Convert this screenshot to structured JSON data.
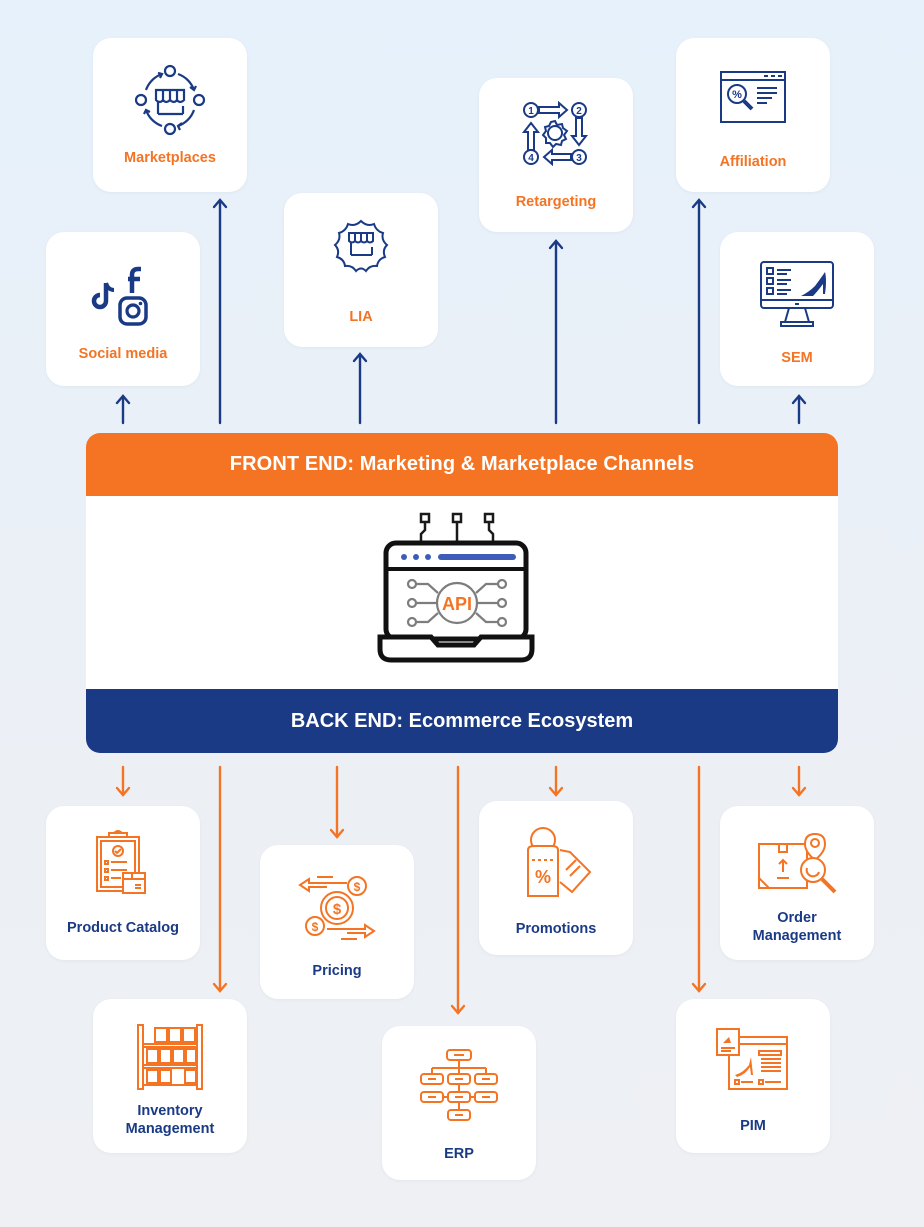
{
  "hub": {
    "front_end_label": "FRONT END: Marketing & Marketplace Channels",
    "back_end_label": "BACK END: Ecommerce Ecosystem",
    "center_icon_text": "API"
  },
  "front_end_channels": [
    {
      "id": "marketplaces",
      "label": "Marketplaces",
      "icon": "marketplace-cycle-icon"
    },
    {
      "id": "social-media",
      "label": "Social media",
      "icon": "social-media-icon"
    },
    {
      "id": "lia",
      "label": "LIA",
      "icon": "store-badge-icon"
    },
    {
      "id": "retargeting",
      "label": "Retargeting",
      "icon": "retargeting-cycle-icon"
    },
    {
      "id": "affiliation",
      "label": "Affiliation",
      "icon": "browser-discount-search-icon"
    },
    {
      "id": "sem",
      "label": "SEM",
      "icon": "monitor-product-icon"
    }
  ],
  "back_end_systems": [
    {
      "id": "product-catalog",
      "label": "Product Catalog",
      "icon": "clipboard-box-icon"
    },
    {
      "id": "inventory-management",
      "label": "Inventory Management",
      "icon": "warehouse-shelf-icon"
    },
    {
      "id": "pricing",
      "label": "Pricing",
      "icon": "currency-exchange-icon"
    },
    {
      "id": "erp",
      "label": "ERP",
      "icon": "org-chart-icon"
    },
    {
      "id": "promotions",
      "label": "Promotions",
      "icon": "discount-tags-icon"
    },
    {
      "id": "order-management",
      "label": "Order Management",
      "icon": "package-tracking-icon"
    },
    {
      "id": "pim",
      "label": "PIM",
      "icon": "product-info-window-icon"
    }
  ],
  "colors": {
    "orange": "#f47424",
    "navy": "#1a3a85",
    "background": "#e9f1f9",
    "card": "#ffffff"
  }
}
